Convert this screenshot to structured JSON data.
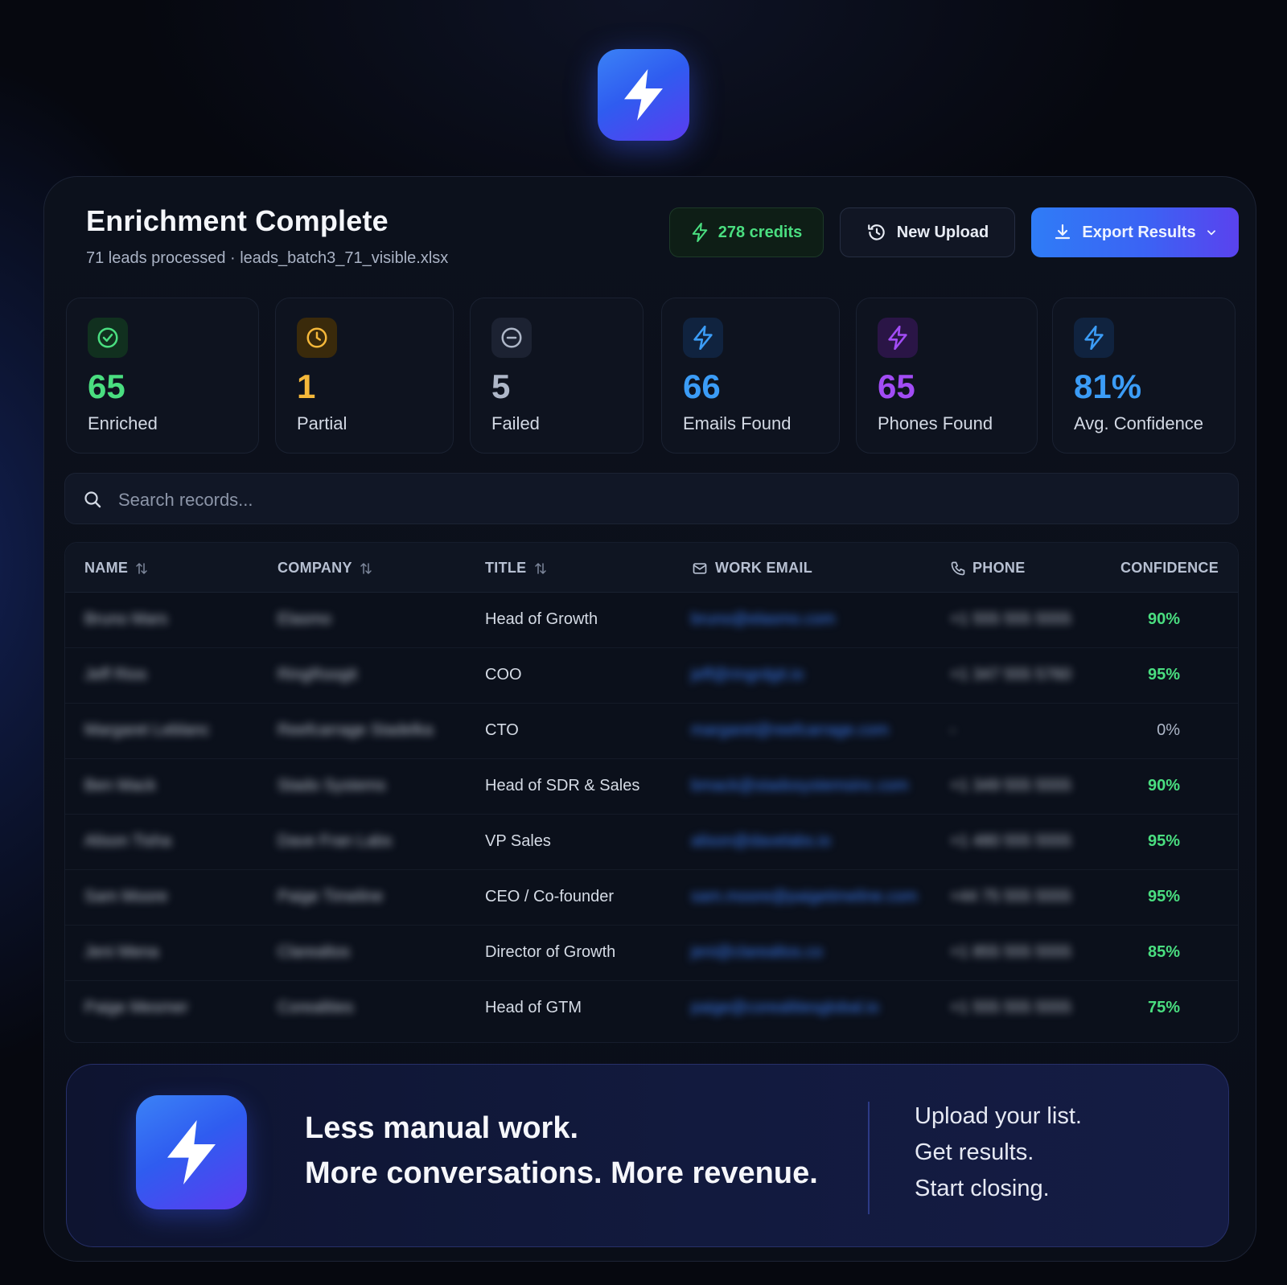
{
  "header": {
    "title": "Enrichment Complete",
    "subtitle": "71 leads processed · leads_batch3_71_visible.xlsx",
    "credits_label": "278 credits",
    "new_upload_label": "New Upload",
    "export_label": "Export Results"
  },
  "stats": [
    {
      "value": "65",
      "label": "Enriched",
      "icon": "check-circle-icon",
      "color": "#4ade80"
    },
    {
      "value": "1",
      "label": "Partial",
      "icon": "clock-icon",
      "color": "#f5b83a"
    },
    {
      "value": "5",
      "label": "Failed",
      "icon": "minus-circle-icon",
      "color": "#aeb7c8"
    },
    {
      "value": "66",
      "label": "Emails Found",
      "icon": "bolt-icon",
      "color": "#3b9cf6"
    },
    {
      "value": "65",
      "label": "Phones Found",
      "icon": "bolt-icon",
      "color": "#a24cf5"
    },
    {
      "value": "81%",
      "label": "Avg. Confidence",
      "icon": "bolt-icon",
      "color": "#3b9cf6"
    }
  ],
  "search": {
    "placeholder": "Search records..."
  },
  "table": {
    "columns": [
      "NAME",
      "COMPANY",
      "TITLE",
      "WORK EMAIL",
      "PHONE",
      "CONFIDENCE"
    ],
    "rows": [
      {
        "name": "Bruno Mars",
        "company": "Elasmo",
        "title": "Head of Growth",
        "email": "bruno@elasmo.com",
        "phone": "+1 555 555 5555",
        "confidence": "90%"
      },
      {
        "name": "Jeff Rios",
        "company": "RingRoogit",
        "title": "COO",
        "email": "jeff@ringrdgit.io",
        "phone": "+1 347 555 5760",
        "confidence": "95%"
      },
      {
        "name": "Margaret Leblanc",
        "company": "Reefcarrage Stadelka",
        "title": "CTO",
        "email": "margaret@reefcarrage.com",
        "phone": "-",
        "confidence": "0%"
      },
      {
        "name": "Ben Mack",
        "company": "Stado Systems",
        "title": "Head of SDR & Sales",
        "email": "bmack@stadosystemsinc.com",
        "phone": "+1 349 555 5555",
        "confidence": "90%"
      },
      {
        "name": "Alison Tisha",
        "company": "Dave Fran Labs",
        "title": "VP Sales",
        "email": "alison@davelabs.io",
        "phone": "+1 480 555 5555",
        "confidence": "95%"
      },
      {
        "name": "Sam Moore",
        "company": "Paige Timeline",
        "title": "CEO / Co-founder",
        "email": "sam.moore@paigetimeline.com",
        "phone": "+44 75 555 5555",
        "confidence": "95%"
      },
      {
        "name": "Jeni Mena",
        "company": "Clarealtos",
        "title": "Director of Growth",
        "email": "jeni@clarealtos.co",
        "phone": "+1 855 555 5555",
        "confidence": "85%"
      },
      {
        "name": "Paige Mesmer",
        "company": "Corealities",
        "title": "Head of GTM",
        "email": "paige@corealitiesglobal.io",
        "phone": "+1 555 555 5555",
        "confidence": "75%"
      }
    ]
  },
  "banner": {
    "headline_1": "Less manual work.",
    "headline_2": "More conversations. More revenue.",
    "tag_1": "Upload your list.",
    "tag_2": "Get results.",
    "tag_3": "Start closing."
  },
  "colors": {
    "accent": "#3b63f4",
    "success": "#4ade80",
    "warning": "#f5b83a",
    "purple": "#a24cf5",
    "email_link": "#3b7bf0"
  }
}
